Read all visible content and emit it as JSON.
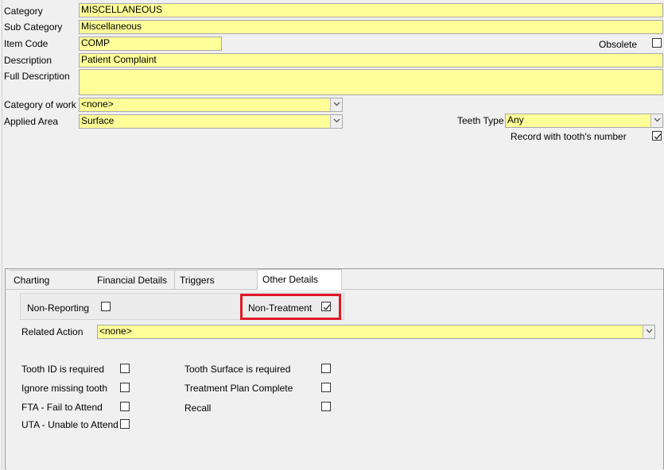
{
  "form": {
    "category": {
      "label": "Category",
      "value": "MISCELLANEOUS"
    },
    "sub_category": {
      "label": "Sub Category",
      "value": "Miscellaneous"
    },
    "item_code": {
      "label": "Item Code",
      "value": "COMP"
    },
    "obsolete": {
      "label": "Obsolete",
      "checked": false
    },
    "description": {
      "label": "Description",
      "value": "Patient Complaint"
    },
    "full_description": {
      "label": "Full Description",
      "value": ""
    },
    "category_of_work": {
      "label": "Category of work",
      "value": "<none>"
    },
    "applied_area": {
      "label": "Applied Area",
      "value": "Surface"
    },
    "teeth_type": {
      "label": "Teeth Type",
      "value": "Any"
    },
    "record_tooth_number": {
      "label": "Record with tooth's number",
      "checked": true
    }
  },
  "tabs": [
    {
      "label": "Charting",
      "active": false
    },
    {
      "label": "Financial Details",
      "active": false
    },
    {
      "label": "Triggers",
      "active": false
    },
    {
      "label": "Other Details",
      "active": true
    }
  ],
  "other_details": {
    "non_reporting": {
      "label": "Non-Reporting",
      "checked": false
    },
    "non_treatment": {
      "label": "Non-Treatment",
      "checked": true
    },
    "related_action": {
      "label": "Related Action",
      "value": "<none>"
    },
    "tooth_id_required": {
      "label": "Tooth ID is required",
      "checked": false
    },
    "ignore_missing_tooth": {
      "label": "Ignore missing tooth",
      "checked": false
    },
    "fta": {
      "label": "FTA - Fail to Attend",
      "checked": false
    },
    "uta": {
      "label": "UTA - Unable to Attend",
      "checked": false
    },
    "tooth_surface_required": {
      "label": "Tooth Surface is required",
      "checked": false
    },
    "treatment_plan_complete": {
      "label": "Treatment Plan Complete",
      "checked": false
    },
    "recall": {
      "label": "Recall",
      "checked": false
    }
  },
  "icons": {
    "dropdown": "chevron-down-icon",
    "check": "check-icon"
  },
  "colors": {
    "field_bg": "#ffff99",
    "highlight_border": "#e01b24"
  }
}
